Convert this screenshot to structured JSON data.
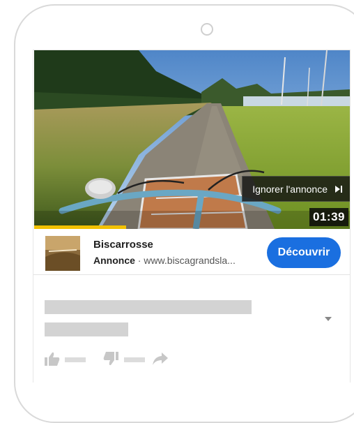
{
  "ad": {
    "skip_label": "Ignorer l'annonce",
    "duration": "01:39",
    "progress_fraction": 0.29,
    "advertiser": "Biscarrosse",
    "sponsored_label": "Annonce",
    "url": "· www.biscagrandsla...",
    "cta_label": "Découvrir"
  },
  "colors": {
    "cta": "#1a6fe0",
    "progress": "#f2c100",
    "placeholder": "#d3d3d3"
  },
  "icons": [
    "skip-next-icon",
    "thumbs-up-icon",
    "thumbs-down-icon",
    "share-icon",
    "chevron-down-icon"
  ]
}
